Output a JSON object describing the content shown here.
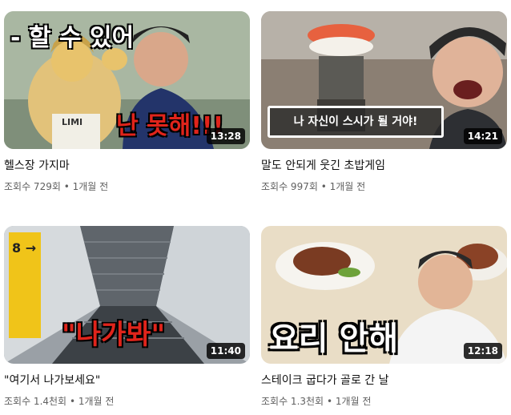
{
  "videos": [
    {
      "duration": "13:28",
      "title": "헬스장 가지마",
      "views": "조회수 729회",
      "age": "1개월 전",
      "overlay_top": "- 할 수 있어",
      "overlay_bottom": "난 못해!!!",
      "shirt_text": "LIMI"
    },
    {
      "duration": "14:21",
      "title": "말도 안되게 웃긴 초밥게임",
      "views": "조회수 997회",
      "age": "1개월 전",
      "overlay_caption": "나 자신이 스시가 될 거야!"
    },
    {
      "duration": "11:40",
      "title": "\"여기서 나가보세요\"",
      "views": "조회수 1.4천회",
      "age": "1개월 전",
      "overlay_text": "\"나가봐\"",
      "sign_text": "8 →"
    },
    {
      "duration": "12:18",
      "title": "스테이크 굽다가 골로 간 날",
      "views": "조회수 1.3천회",
      "age": "1개월 전",
      "overlay_text": "요리 안해"
    }
  ],
  "separator": "•"
}
